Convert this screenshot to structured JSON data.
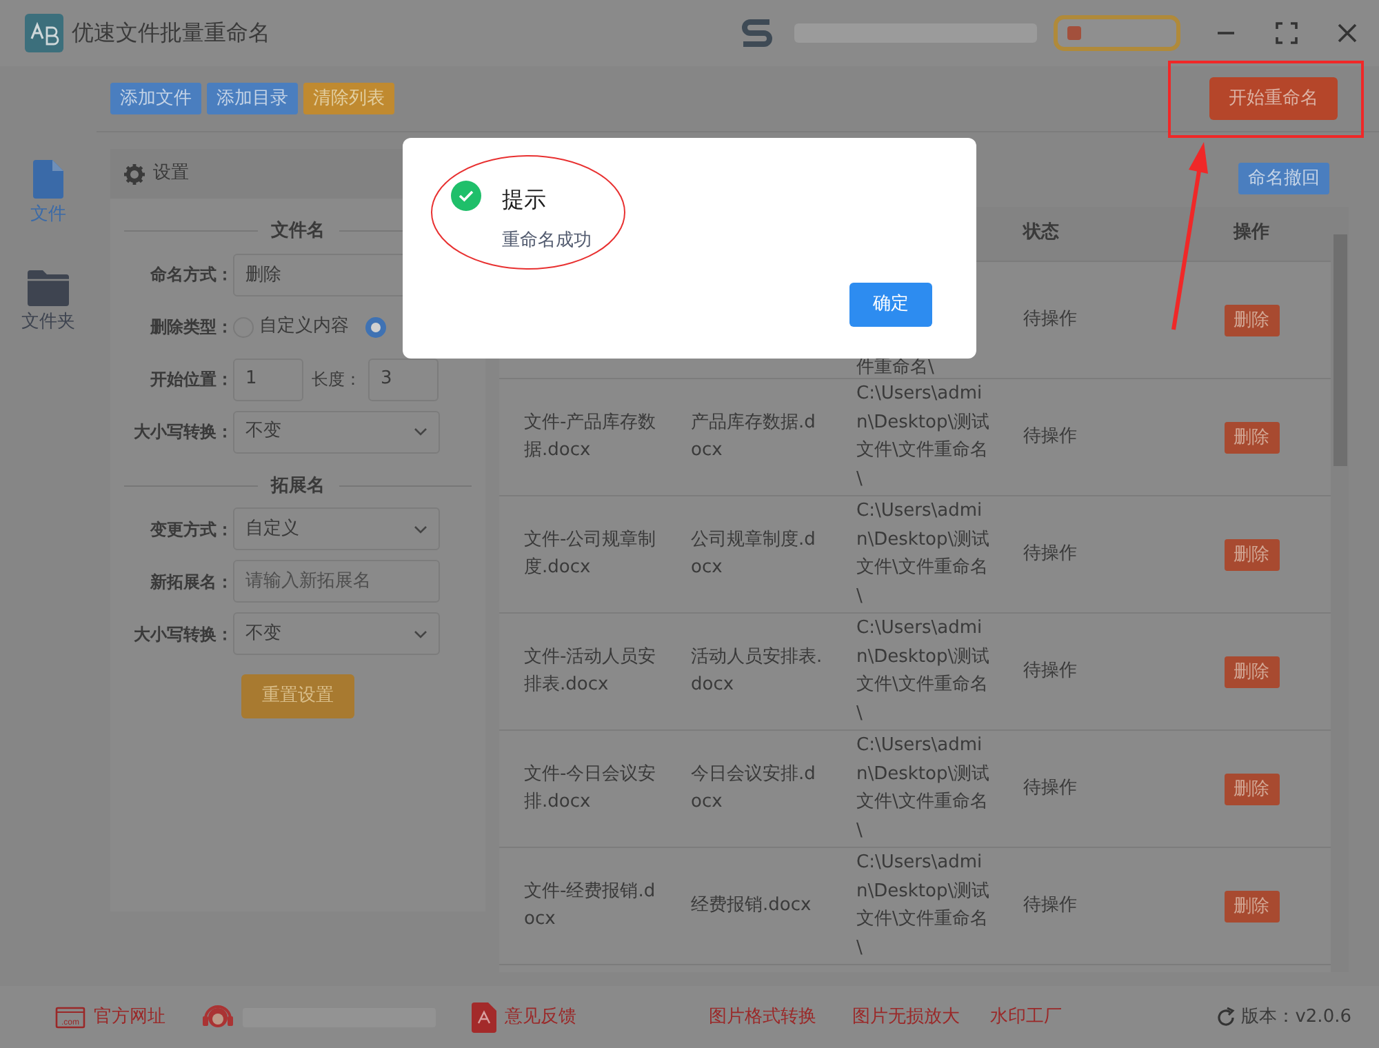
{
  "window": {
    "title": "优速文件批量重命名"
  },
  "toolbar": {
    "buttons": [
      {
        "label": "添加文件",
        "kind": "primary"
      },
      {
        "label": "添加目录",
        "kind": "primary"
      },
      {
        "label": "清除列表",
        "kind": "warning"
      }
    ],
    "start_button": "开始重命名"
  },
  "sidebar": {
    "items": [
      {
        "label": "文件",
        "kind": "file",
        "selected": true
      },
      {
        "label": "文件夹",
        "kind": "folder",
        "selected": false
      }
    ]
  },
  "settings": {
    "title": "设置",
    "sections": [
      {
        "heading": "文件名",
        "fields": [
          {
            "kind": "text",
            "label": "命名方式：",
            "value": "删除"
          },
          {
            "kind": "radio",
            "label": "删除类型：",
            "options": [
              {
                "label": "自定义内容",
                "selected": false
              },
              {
                "selected": true
              }
            ]
          },
          {
            "kind": "pair",
            "label": "开始位置：",
            "value": "1",
            "label2": "长度：",
            "value2": "3"
          },
          {
            "kind": "select",
            "label": "大小写转换：",
            "value": "不变"
          }
        ]
      },
      {
        "heading": "拓展名",
        "fields": [
          {
            "kind": "select",
            "label": "变更方式：",
            "value": "自定义"
          },
          {
            "kind": "text",
            "label": "新拓展名：",
            "placeholder": "请输入新拓展名"
          },
          {
            "kind": "select",
            "label": "大小写转换：",
            "value": "不变"
          }
        ]
      }
    ],
    "reset_button": "重置设置"
  },
  "undo_button": "命名撤回",
  "table": {
    "columns": [
      {
        "label": "状态"
      },
      {
        "label": "操作"
      }
    ],
    "rows": [
      {
        "column_3": "件重命名\\",
        "status": "待操作",
        "action": "删除"
      },
      {
        "column_1": "文件-产品库存数据.docx",
        "column_2": "产品库存数据.docx",
        "column_3": "C:\\Users\\admin\\Desktop\\测试文件\\文件重命名\\",
        "status": "待操作",
        "action": "删除"
      },
      {
        "column_1": "文件-公司规章制度.docx",
        "column_2": "公司规章制度.docx",
        "column_3": "C:\\Users\\admin\\Desktop\\测试文件\\文件重命名\\",
        "status": "待操作",
        "action": "删除"
      },
      {
        "column_1": "文件-活动人员安排表.docx",
        "column_2": "活动人员安排表.docx",
        "column_3": "C:\\Users\\admin\\Desktop\\测试文件\\文件重命名\\",
        "status": "待操作",
        "action": "删除"
      },
      {
        "column_1": "文件-今日会议安排.docx",
        "column_2": "今日会议安排.docx",
        "column_3": "C:\\Users\\admin\\Desktop\\测试文件\\文件重命名\\",
        "status": "待操作",
        "action": "删除"
      },
      {
        "column_1": "文件-经费报销.docx",
        "column_2": "经费报销.docx",
        "column_3": "C:\\Users\\admin\\Desktop\\测试文件\\文件重命名\\",
        "status": "待操作",
        "action": "删除"
      }
    ]
  },
  "dialog": {
    "kind": "success",
    "title": "提示",
    "message": "重命名成功",
    "button": "确定"
  },
  "footer": {
    "links": [
      {
        "kind": "web",
        "icon_text": ".com",
        "label": "官方网址"
      },
      {
        "kind": "support"
      },
      {
        "kind": "pdf",
        "label": "意见反馈"
      },
      {
        "kind": "plain",
        "label": "图片格式转换"
      },
      {
        "kind": "plain",
        "label": "图片无损放大"
      },
      {
        "kind": "plain",
        "label": "水印工厂"
      }
    ],
    "version": "版本：v2.0.6"
  }
}
